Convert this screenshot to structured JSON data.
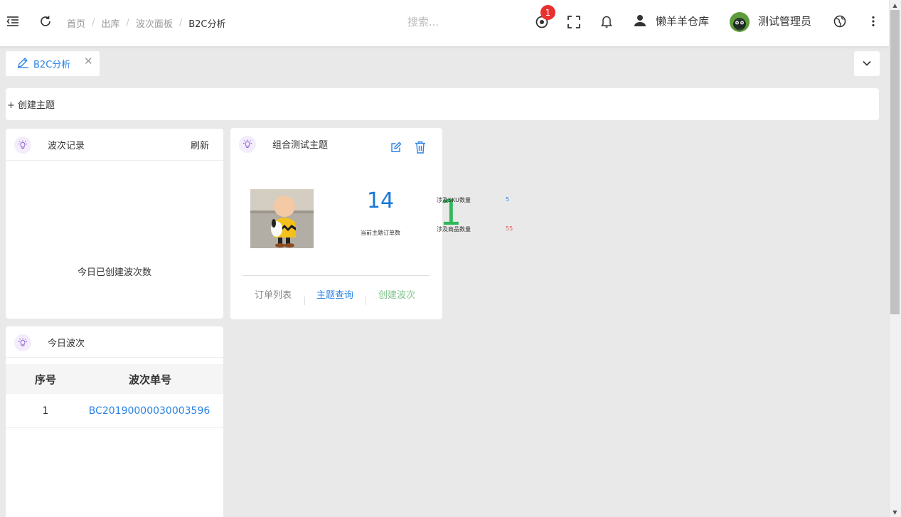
{
  "header": {
    "breadcrumb": [
      {
        "label": "首页"
      },
      {
        "label": "出库"
      },
      {
        "label": "波次面板"
      },
      {
        "label": "B2C分析"
      }
    ],
    "search_placeholder": "搜索...",
    "notification_count": "1",
    "warehouse": "懒羊羊仓库",
    "username": "测试管理员"
  },
  "tabs": [
    {
      "label": "B2C分析"
    }
  ],
  "toolbar": {
    "create_topic": "+ 创建主题"
  },
  "wave_card": {
    "title": "波次记录",
    "refresh": "刷新",
    "count": "1",
    "count_label": "今日已创建波次数"
  },
  "topic_card": {
    "title": "组合测试主题",
    "order_count": "14",
    "order_count_label": "当前主题订单数",
    "stats": [
      {
        "label": "涉及SKU数量",
        "value": "5",
        "color": "#2a82e4"
      },
      {
        "label": "涉及商品数量",
        "value": "55",
        "color": "#e05a5a"
      }
    ],
    "actions": [
      {
        "label": "订单列表",
        "color": "#888888"
      },
      {
        "label": "主题查询",
        "color": "#2a82e4"
      },
      {
        "label": "创建波次",
        "color": "#7dc28a"
      }
    ]
  },
  "today_card": {
    "title": "今日波次",
    "columns": [
      "序号",
      "波次单号"
    ],
    "rows": [
      {
        "index": "1",
        "wave_no": "BC20190000030003596"
      }
    ]
  },
  "colors": {
    "accent": "#2a82e4",
    "count_green": "#30b85a",
    "metric_blue": "#1a78d8",
    "badge_red": "#ea2f2f"
  }
}
